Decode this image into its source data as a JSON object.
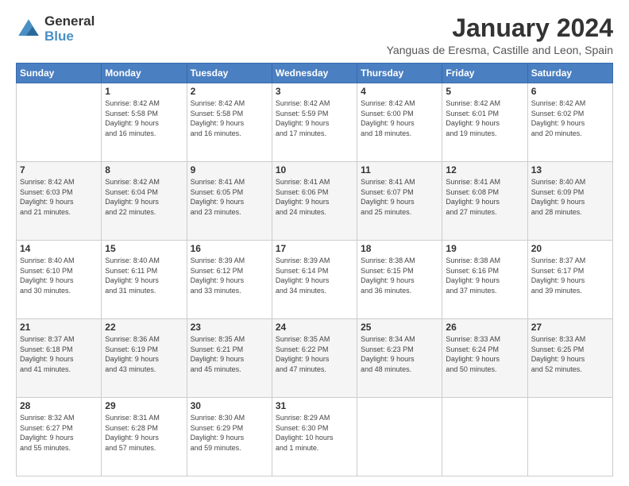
{
  "logo": {
    "line1": "General",
    "line2": "Blue"
  },
  "title": "January 2024",
  "location": "Yanguas de Eresma, Castille and Leon, Spain",
  "weekdays": [
    "Sunday",
    "Monday",
    "Tuesday",
    "Wednesday",
    "Thursday",
    "Friday",
    "Saturday"
  ],
  "weeks": [
    [
      {
        "day": "",
        "info": ""
      },
      {
        "day": "1",
        "info": "Sunrise: 8:42 AM\nSunset: 5:58 PM\nDaylight: 9 hours\nand 16 minutes."
      },
      {
        "day": "2",
        "info": "Sunrise: 8:42 AM\nSunset: 5:58 PM\nDaylight: 9 hours\nand 16 minutes."
      },
      {
        "day": "3",
        "info": "Sunrise: 8:42 AM\nSunset: 5:59 PM\nDaylight: 9 hours\nand 17 minutes."
      },
      {
        "day": "4",
        "info": "Sunrise: 8:42 AM\nSunset: 6:00 PM\nDaylight: 9 hours\nand 18 minutes."
      },
      {
        "day": "5",
        "info": "Sunrise: 8:42 AM\nSunset: 6:01 PM\nDaylight: 9 hours\nand 19 minutes."
      },
      {
        "day": "6",
        "info": "Sunrise: 8:42 AM\nSunset: 6:02 PM\nDaylight: 9 hours\nand 20 minutes."
      }
    ],
    [
      {
        "day": "7",
        "info": "Sunrise: 8:42 AM\nSunset: 6:03 PM\nDaylight: 9 hours\nand 21 minutes."
      },
      {
        "day": "8",
        "info": "Sunrise: 8:42 AM\nSunset: 6:04 PM\nDaylight: 9 hours\nand 22 minutes."
      },
      {
        "day": "9",
        "info": "Sunrise: 8:41 AM\nSunset: 6:05 PM\nDaylight: 9 hours\nand 23 minutes."
      },
      {
        "day": "10",
        "info": "Sunrise: 8:41 AM\nSunset: 6:06 PM\nDaylight: 9 hours\nand 24 minutes."
      },
      {
        "day": "11",
        "info": "Sunrise: 8:41 AM\nSunset: 6:07 PM\nDaylight: 9 hours\nand 25 minutes."
      },
      {
        "day": "12",
        "info": "Sunrise: 8:41 AM\nSunset: 6:08 PM\nDaylight: 9 hours\nand 27 minutes."
      },
      {
        "day": "13",
        "info": "Sunrise: 8:40 AM\nSunset: 6:09 PM\nDaylight: 9 hours\nand 28 minutes."
      }
    ],
    [
      {
        "day": "14",
        "info": "Sunrise: 8:40 AM\nSunset: 6:10 PM\nDaylight: 9 hours\nand 30 minutes."
      },
      {
        "day": "15",
        "info": "Sunrise: 8:40 AM\nSunset: 6:11 PM\nDaylight: 9 hours\nand 31 minutes."
      },
      {
        "day": "16",
        "info": "Sunrise: 8:39 AM\nSunset: 6:12 PM\nDaylight: 9 hours\nand 33 minutes."
      },
      {
        "day": "17",
        "info": "Sunrise: 8:39 AM\nSunset: 6:14 PM\nDaylight: 9 hours\nand 34 minutes."
      },
      {
        "day": "18",
        "info": "Sunrise: 8:38 AM\nSunset: 6:15 PM\nDaylight: 9 hours\nand 36 minutes."
      },
      {
        "day": "19",
        "info": "Sunrise: 8:38 AM\nSunset: 6:16 PM\nDaylight: 9 hours\nand 37 minutes."
      },
      {
        "day": "20",
        "info": "Sunrise: 8:37 AM\nSunset: 6:17 PM\nDaylight: 9 hours\nand 39 minutes."
      }
    ],
    [
      {
        "day": "21",
        "info": "Sunrise: 8:37 AM\nSunset: 6:18 PM\nDaylight: 9 hours\nand 41 minutes."
      },
      {
        "day": "22",
        "info": "Sunrise: 8:36 AM\nSunset: 6:19 PM\nDaylight: 9 hours\nand 43 minutes."
      },
      {
        "day": "23",
        "info": "Sunrise: 8:35 AM\nSunset: 6:21 PM\nDaylight: 9 hours\nand 45 minutes."
      },
      {
        "day": "24",
        "info": "Sunrise: 8:35 AM\nSunset: 6:22 PM\nDaylight: 9 hours\nand 47 minutes."
      },
      {
        "day": "25",
        "info": "Sunrise: 8:34 AM\nSunset: 6:23 PM\nDaylight: 9 hours\nand 48 minutes."
      },
      {
        "day": "26",
        "info": "Sunrise: 8:33 AM\nSunset: 6:24 PM\nDaylight: 9 hours\nand 50 minutes."
      },
      {
        "day": "27",
        "info": "Sunrise: 8:33 AM\nSunset: 6:25 PM\nDaylight: 9 hours\nand 52 minutes."
      }
    ],
    [
      {
        "day": "28",
        "info": "Sunrise: 8:32 AM\nSunset: 6:27 PM\nDaylight: 9 hours\nand 55 minutes."
      },
      {
        "day": "29",
        "info": "Sunrise: 8:31 AM\nSunset: 6:28 PM\nDaylight: 9 hours\nand 57 minutes."
      },
      {
        "day": "30",
        "info": "Sunrise: 8:30 AM\nSunset: 6:29 PM\nDaylight: 9 hours\nand 59 minutes."
      },
      {
        "day": "31",
        "info": "Sunrise: 8:29 AM\nSunset: 6:30 PM\nDaylight: 10 hours\nand 1 minute."
      },
      {
        "day": "",
        "info": ""
      },
      {
        "day": "",
        "info": ""
      },
      {
        "day": "",
        "info": ""
      }
    ]
  ]
}
